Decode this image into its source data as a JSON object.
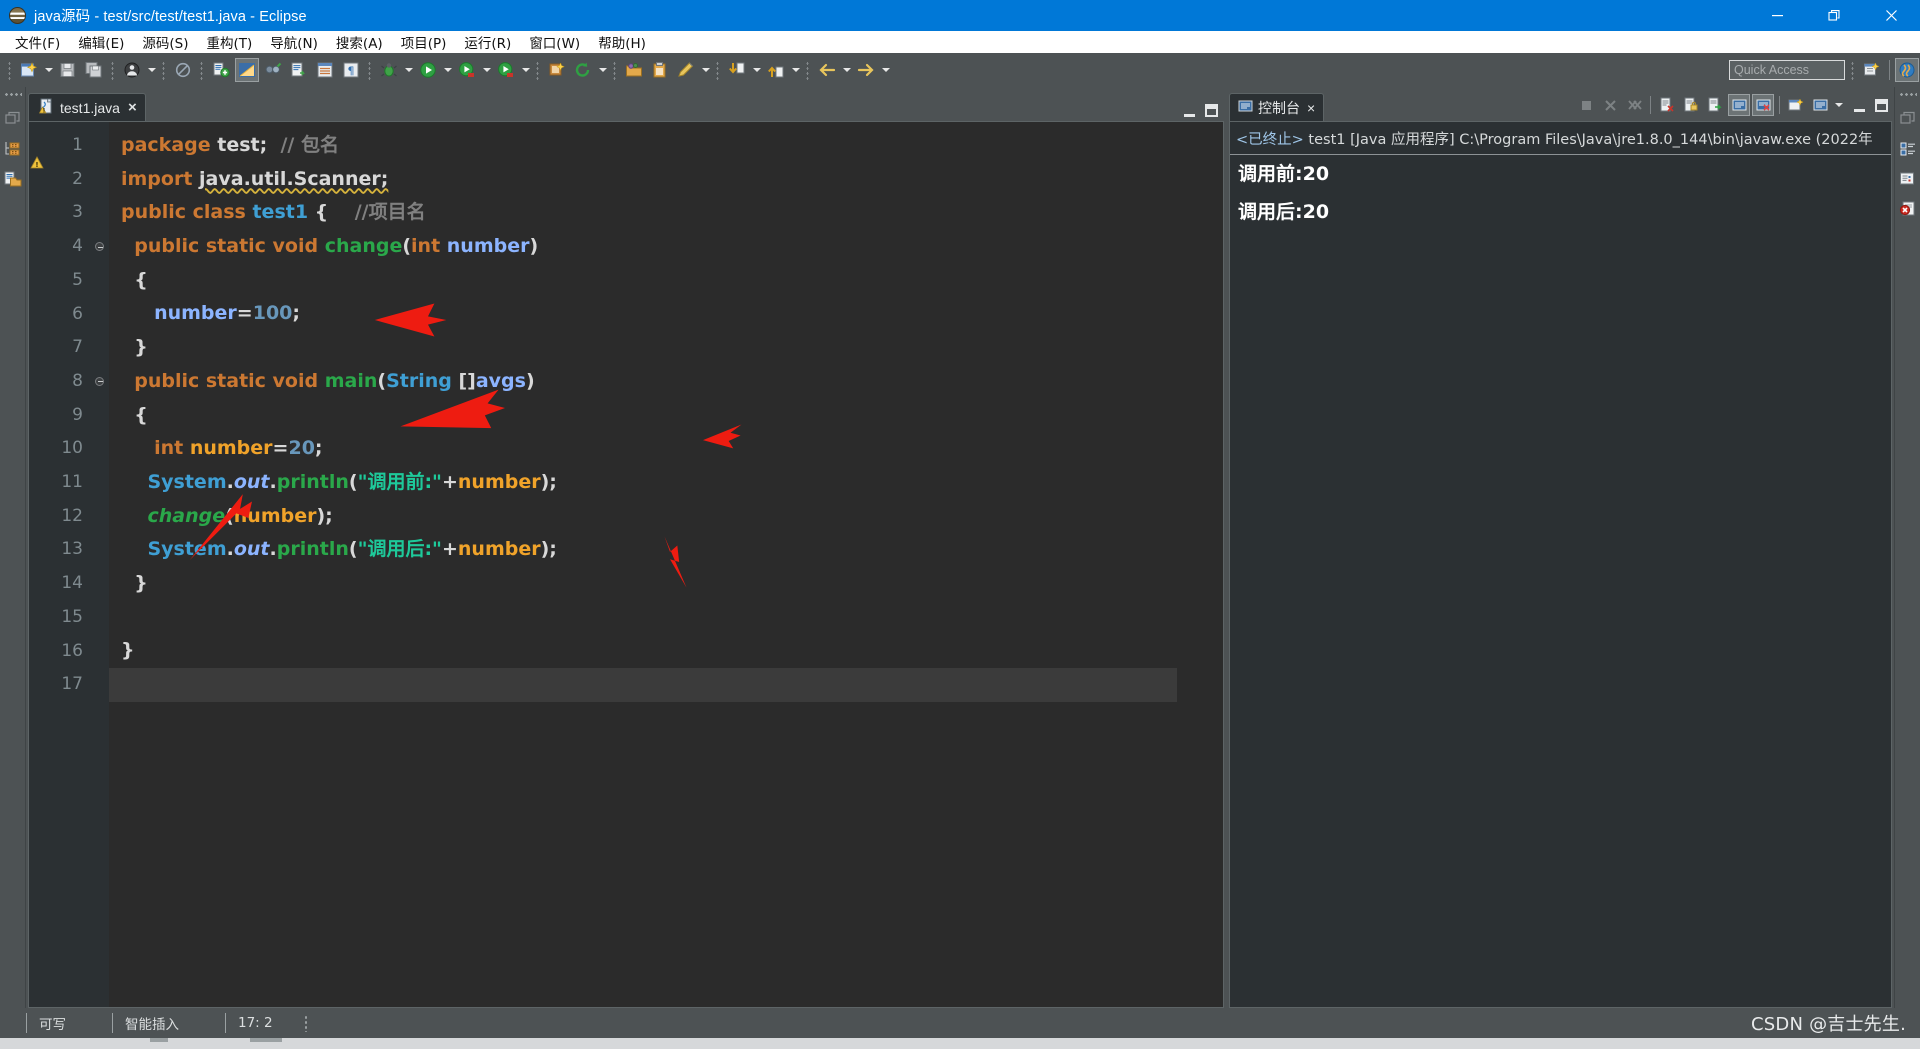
{
  "window": {
    "title": "java源码 - test/src/test/test1.java - Eclipse",
    "app_icon": "eclipse-icon",
    "controls": {
      "minimize": "minimize-icon",
      "restore": "restore-icon",
      "close": "close-icon"
    }
  },
  "menubar": {
    "items": [
      {
        "label": "文件(F)",
        "mnemonic": "F"
      },
      {
        "label": "编辑(E)",
        "mnemonic": "E"
      },
      {
        "label": "源码(S)",
        "mnemonic": "S"
      },
      {
        "label": "重构(T)",
        "mnemonic": "T"
      },
      {
        "label": "导航(N)",
        "mnemonic": "N"
      },
      {
        "label": "搜索(A)",
        "mnemonic": "A"
      },
      {
        "label": "项目(P)",
        "mnemonic": "P"
      },
      {
        "label": "运行(R)",
        "mnemonic": "R"
      },
      {
        "label": "窗口(W)",
        "mnemonic": "W"
      },
      {
        "label": "帮助(H)",
        "mnemonic": "H"
      }
    ]
  },
  "toolbar": {
    "quick_access_placeholder": "Quick Access",
    "icons": [
      "new-wizard-icon",
      "save-icon",
      "save-all-icon",
      "print-icon",
      "toggle-breadcrumb-icon",
      "new-java-project-icon",
      "java-perspective-icon",
      "external-tools-icon",
      "open-task-icon",
      "open-type-icon",
      "search-icon",
      "debug-icon",
      "run-icon",
      "run-last-icon",
      "coverage-icon",
      "new-class-icon",
      "refresh-icon",
      "open-package-icon",
      "paste-icon",
      "edit-icon",
      "next-annotation-icon",
      "previous-annotation-icon",
      "back-icon",
      "forward-icon",
      "open-perspective-icon",
      "open-java-perspective-icon"
    ]
  },
  "left_fastbar": {
    "icons": [
      "restore-view-icon",
      "package-explorer-icon",
      "project-explorer-icon"
    ]
  },
  "right_fastbar": {
    "icons": [
      "restore-view-icon",
      "outline-icon",
      "task-list-icon",
      "error-log-icon"
    ]
  },
  "editor": {
    "tab": {
      "label": "test1.java",
      "close": "×",
      "icon": "java-file-warning-icon"
    },
    "panel_controls": {
      "minimize": "minimize-icon",
      "maximize": "maximize-icon"
    },
    "current_line": 17,
    "total_lines": 17,
    "lines": [
      {
        "n": 1,
        "folding": false,
        "tokens": [
          {
            "t": "package ",
            "c": "k"
          },
          {
            "t": "test",
            "c": "pl"
          },
          {
            "t": ";",
            "c": "pl"
          },
          {
            "t": "  ",
            "c": "pl"
          },
          {
            "t": "// 包名",
            "c": "cmt"
          }
        ]
      },
      {
        "n": 2,
        "folding": false,
        "tokens": [
          {
            "t": "import ",
            "c": "k"
          },
          {
            "t": "java.util.Scanner;",
            "c": "pl squiggle"
          }
        ]
      },
      {
        "n": 3,
        "folding": false,
        "tokens": [
          {
            "t": "public class ",
            "c": "k"
          },
          {
            "t": "test1",
            "c": "cls"
          },
          {
            "t": " {",
            "c": "pl"
          },
          {
            "t": "    ",
            "c": "pl"
          },
          {
            "t": "//项目名",
            "c": "cmt"
          }
        ]
      },
      {
        "n": 4,
        "folding": true,
        "tokens": [
          {
            "t": "  ",
            "c": "pl"
          },
          {
            "t": "public static void ",
            "c": "k"
          },
          {
            "t": "change",
            "c": "mth"
          },
          {
            "t": "(",
            "c": "pl"
          },
          {
            "t": "int ",
            "c": "k"
          },
          {
            "t": "number",
            "c": "fld"
          },
          {
            "t": ")",
            "c": "pl"
          }
        ]
      },
      {
        "n": 5,
        "folding": false,
        "tokens": [
          {
            "t": "  {",
            "c": "pl"
          }
        ]
      },
      {
        "n": 6,
        "folding": false,
        "tokens": [
          {
            "t": "     ",
            "c": "pl"
          },
          {
            "t": "number",
            "c": "fld"
          },
          {
            "t": "=",
            "c": "pl"
          },
          {
            "t": "100",
            "c": "num"
          },
          {
            "t": ";",
            "c": "pl"
          }
        ]
      },
      {
        "n": 7,
        "folding": false,
        "tokens": [
          {
            "t": "  }",
            "c": "pl"
          }
        ]
      },
      {
        "n": 8,
        "folding": true,
        "tokens": [
          {
            "t": "  ",
            "c": "pl"
          },
          {
            "t": "public static void ",
            "c": "k"
          },
          {
            "t": "main",
            "c": "mth"
          },
          {
            "t": "(",
            "c": "pl"
          },
          {
            "t": "String",
            "c": "cls"
          },
          {
            "t": " []",
            "c": "pl"
          },
          {
            "t": "avgs",
            "c": "fld"
          },
          {
            "t": ")",
            "c": "pl"
          }
        ]
      },
      {
        "n": 9,
        "folding": false,
        "tokens": [
          {
            "t": "  {",
            "c": "pl"
          }
        ]
      },
      {
        "n": 10,
        "folding": false,
        "tokens": [
          {
            "t": "     ",
            "c": "pl"
          },
          {
            "t": "int ",
            "c": "k"
          },
          {
            "t": "number",
            "c": "par"
          },
          {
            "t": "=",
            "c": "pl"
          },
          {
            "t": "20",
            "c": "num"
          },
          {
            "t": ";",
            "c": "pl"
          }
        ]
      },
      {
        "n": 11,
        "folding": false,
        "tokens": [
          {
            "t": "    ",
            "c": "pl"
          },
          {
            "t": "System",
            "c": "cls"
          },
          {
            "t": ".",
            "c": "pl"
          },
          {
            "t": "out",
            "c": "fld ital"
          },
          {
            "t": ".",
            "c": "pl"
          },
          {
            "t": "println",
            "c": "mth"
          },
          {
            "t": "(",
            "c": "pl"
          },
          {
            "t": "\"调用前:\"",
            "c": "str"
          },
          {
            "t": "+",
            "c": "pl"
          },
          {
            "t": "number",
            "c": "par"
          },
          {
            "t": ");",
            "c": "pl"
          }
        ]
      },
      {
        "n": 12,
        "folding": false,
        "tokens": [
          {
            "t": "    ",
            "c": "pl"
          },
          {
            "t": "change",
            "c": "mth ital"
          },
          {
            "t": "(",
            "c": "pl"
          },
          {
            "t": "number",
            "c": "par"
          },
          {
            "t": ");",
            "c": "pl"
          }
        ]
      },
      {
        "n": 13,
        "folding": false,
        "tokens": [
          {
            "t": "    ",
            "c": "pl"
          },
          {
            "t": "System",
            "c": "cls"
          },
          {
            "t": ".",
            "c": "pl"
          },
          {
            "t": "out",
            "c": "fld ital"
          },
          {
            "t": ".",
            "c": "pl"
          },
          {
            "t": "println",
            "c": "mth"
          },
          {
            "t": "(",
            "c": "pl"
          },
          {
            "t": "\"调用后:\"",
            "c": "str"
          },
          {
            "t": "+",
            "c": "pl"
          },
          {
            "t": "number",
            "c": "par"
          },
          {
            "t": ");",
            "c": "pl"
          }
        ]
      },
      {
        "n": 14,
        "folding": false,
        "tokens": [
          {
            "t": "  }",
            "c": "pl"
          }
        ]
      },
      {
        "n": 15,
        "folding": false,
        "tokens": [
          {
            "t": "",
            "c": "pl"
          }
        ]
      },
      {
        "n": 16,
        "folding": false,
        "tokens": [
          {
            "t": "}",
            "c": "pl"
          }
        ]
      },
      {
        "n": 17,
        "folding": false,
        "tokens": [
          {
            "t": "",
            "c": "pl"
          }
        ]
      }
    ]
  },
  "console": {
    "tab": {
      "label": "控制台",
      "close": "×",
      "icon": "console-icon"
    },
    "tool_icons": [
      "terminate-icon",
      "remove-launch-icon",
      "remove-all-launches-icon",
      "clear-console-icon",
      "scroll-lock-icon",
      "word-wrap-icon",
      "show-console-on-output-icon",
      "pin-console-icon",
      "display-selected-console-icon",
      "open-console-icon"
    ],
    "panel_controls": {
      "minimize": "minimize-icon",
      "maximize": "maximize-icon"
    },
    "header_terminated": "<已终止>",
    "header_rest": " test1 [Java 应用程序] C:\\Program Files\\Java\\jre1.8.0_144\\bin\\javaw.exe  (2022年",
    "output": [
      "调用前:20",
      "调用后:20"
    ]
  },
  "statusbar": {
    "writable": "可写",
    "insert_mode": "智能插入",
    "position": "17: 2",
    "watermark": "CSDN @吉士先生."
  },
  "colors": {
    "title_bar": "#0078d7",
    "chrome": "#4d5254",
    "editor_bg": "#2b2b2b",
    "panel_bg": "#2b3033",
    "keyword": "#cc7832",
    "class": "#3f9fd4",
    "method": "#2aa84a",
    "field": "#8cb4ff",
    "parameter": "#f0a32a",
    "number": "#6897bb",
    "string": "#1ec99a",
    "comment": "#808080",
    "annotation_arrow": "#ee1c11"
  }
}
